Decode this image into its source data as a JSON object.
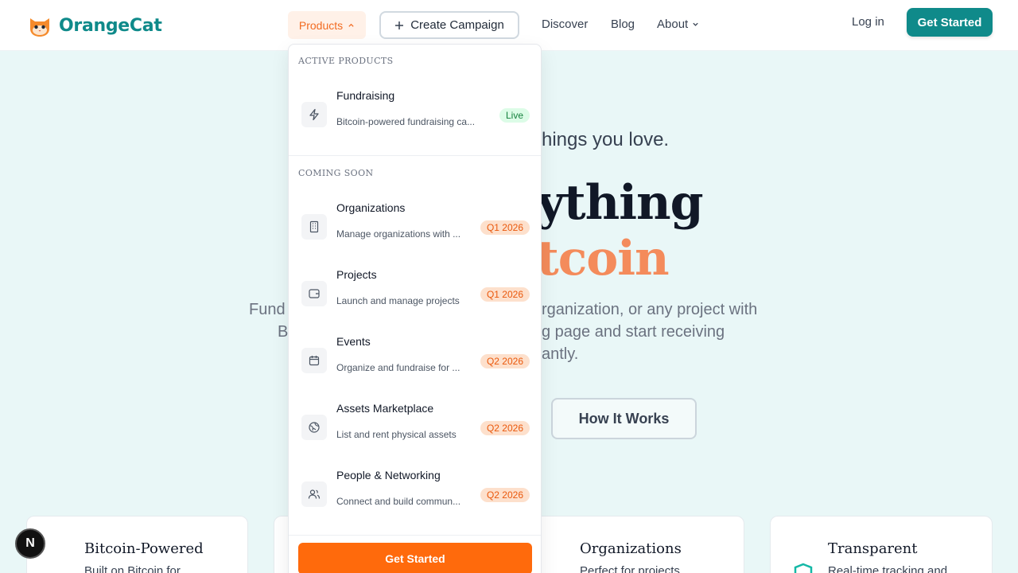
{
  "brand": {
    "name": "OrangeCat",
    "accent": "#0f8a8a",
    "orange": "#f26b21"
  },
  "nav": {
    "products": "Products",
    "create_campaign": "Create Campaign",
    "discover": "Discover",
    "blog": "Blog",
    "about": "About",
    "login": "Log in",
    "get_started": "Get Started"
  },
  "hero": {
    "tagline": "hings you love.",
    "line1": "ything",
    "line2": "tcoin",
    "p1_left": "Fund",
    "p1_right": "rganization, or any project with",
    "p2_left": "B",
    "p2_right": "g page and start receiving",
    "p3_right": "antly.",
    "how_it_works": "How It Works"
  },
  "dropdown": {
    "active_heading": "ACTIVE PRODUCTS",
    "soon_heading": "COMING SOON",
    "active_items": [
      {
        "title": "Fundraising",
        "desc": "Bitcoin-powered fundraising ca...",
        "badge": "Live",
        "icon": "lightning-icon"
      }
    ],
    "soon_items": [
      {
        "title": "Organizations",
        "desc": "Manage organizations with ...",
        "badge": "Q1 2026",
        "icon": "building-icon"
      },
      {
        "title": "Projects",
        "desc": "Launch and manage projects",
        "badge": "Q1 2026",
        "icon": "wallet-icon"
      },
      {
        "title": "Events",
        "desc": "Organize and fundraise for ...",
        "badge": "Q2 2026",
        "icon": "calendar-icon"
      },
      {
        "title": "Assets Marketplace",
        "desc": "List and rent physical assets",
        "badge": "Q2 2026",
        "icon": "globe-icon"
      },
      {
        "title": "People & Networking",
        "desc": "Connect and build commun...",
        "badge": "Q2 2026",
        "icon": "users-icon"
      }
    ],
    "cta": "Get Started"
  },
  "features": [
    {
      "title": "Bitcoin-Powered",
      "desc": "Built on Bitcoin for"
    },
    {
      "title": "Organizations",
      "desc": "Perfect for projects"
    },
    {
      "title": "Transparent",
      "desc": "Real-time tracking and"
    }
  ],
  "dev_badge": "N"
}
